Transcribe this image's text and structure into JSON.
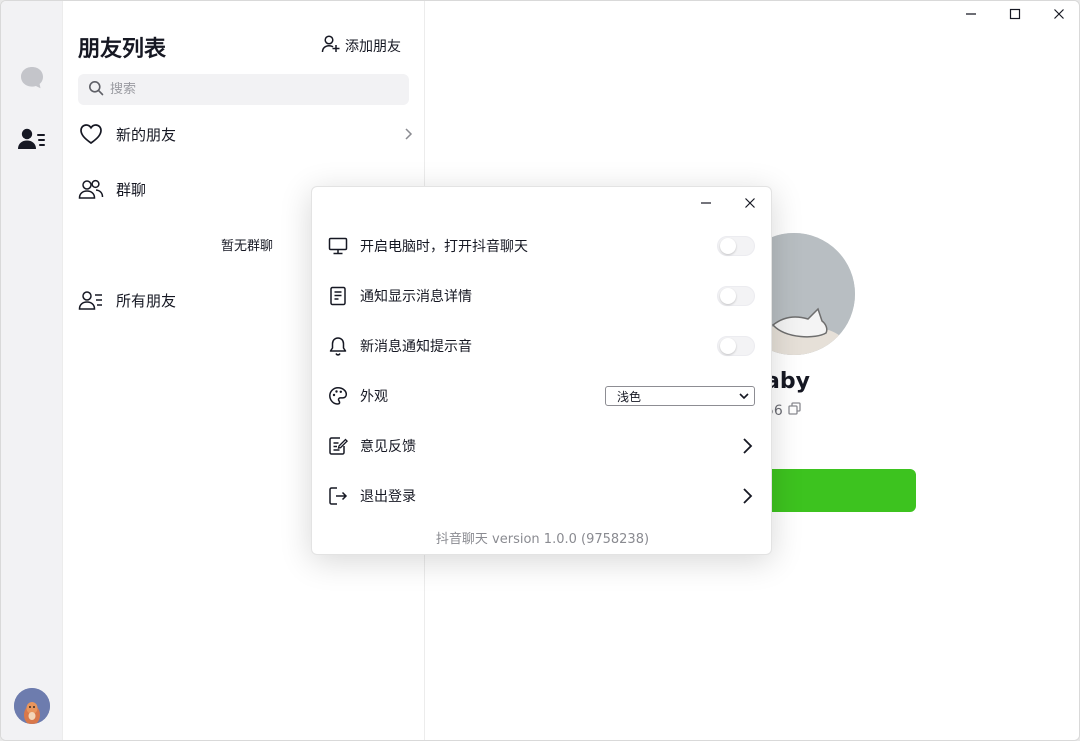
{
  "sidebar": {
    "icons": [
      "chat-bubble-icon",
      "contacts-icon",
      "user-avatar"
    ]
  },
  "friend_list": {
    "title": "朋友列表",
    "add_friend_label": "添加朋友",
    "search_placeholder": "搜索",
    "items": [
      {
        "label": "新的朋友",
        "icon": "heart-icon"
      },
      {
        "label": "群聊",
        "icon": "group-icon"
      },
      {
        "label": "所有朋友",
        "icon": "contacts-icon"
      }
    ],
    "empty_groups_text": "暂无群聊"
  },
  "profile": {
    "name_partial": "aby",
    "id_partial": "56"
  },
  "settings_dialog": {
    "rows": [
      {
        "label": "开启电脑时，打开抖音聊天",
        "icon": "monitor-icon",
        "control": "toggle",
        "on": false
      },
      {
        "label": "通知显示消息详情",
        "icon": "document-icon",
        "control": "toggle",
        "on": false
      },
      {
        "label": "新消息通知提示音",
        "icon": "bell-icon",
        "control": "toggle",
        "on": false
      },
      {
        "label": "外观",
        "icon": "palette-icon",
        "control": "select",
        "value": "浅色"
      },
      {
        "label": "意见反馈",
        "icon": "feedback-icon",
        "control": "chevron"
      },
      {
        "label": "退出登录",
        "icon": "logout-icon",
        "control": "chevron"
      }
    ],
    "version_text": "抖音聊天 version 1.0.0 (9758238)"
  },
  "colors": {
    "accent_green": "#3dc31f",
    "rail_bg": "#f2f2f4",
    "text_primary": "#161823"
  }
}
